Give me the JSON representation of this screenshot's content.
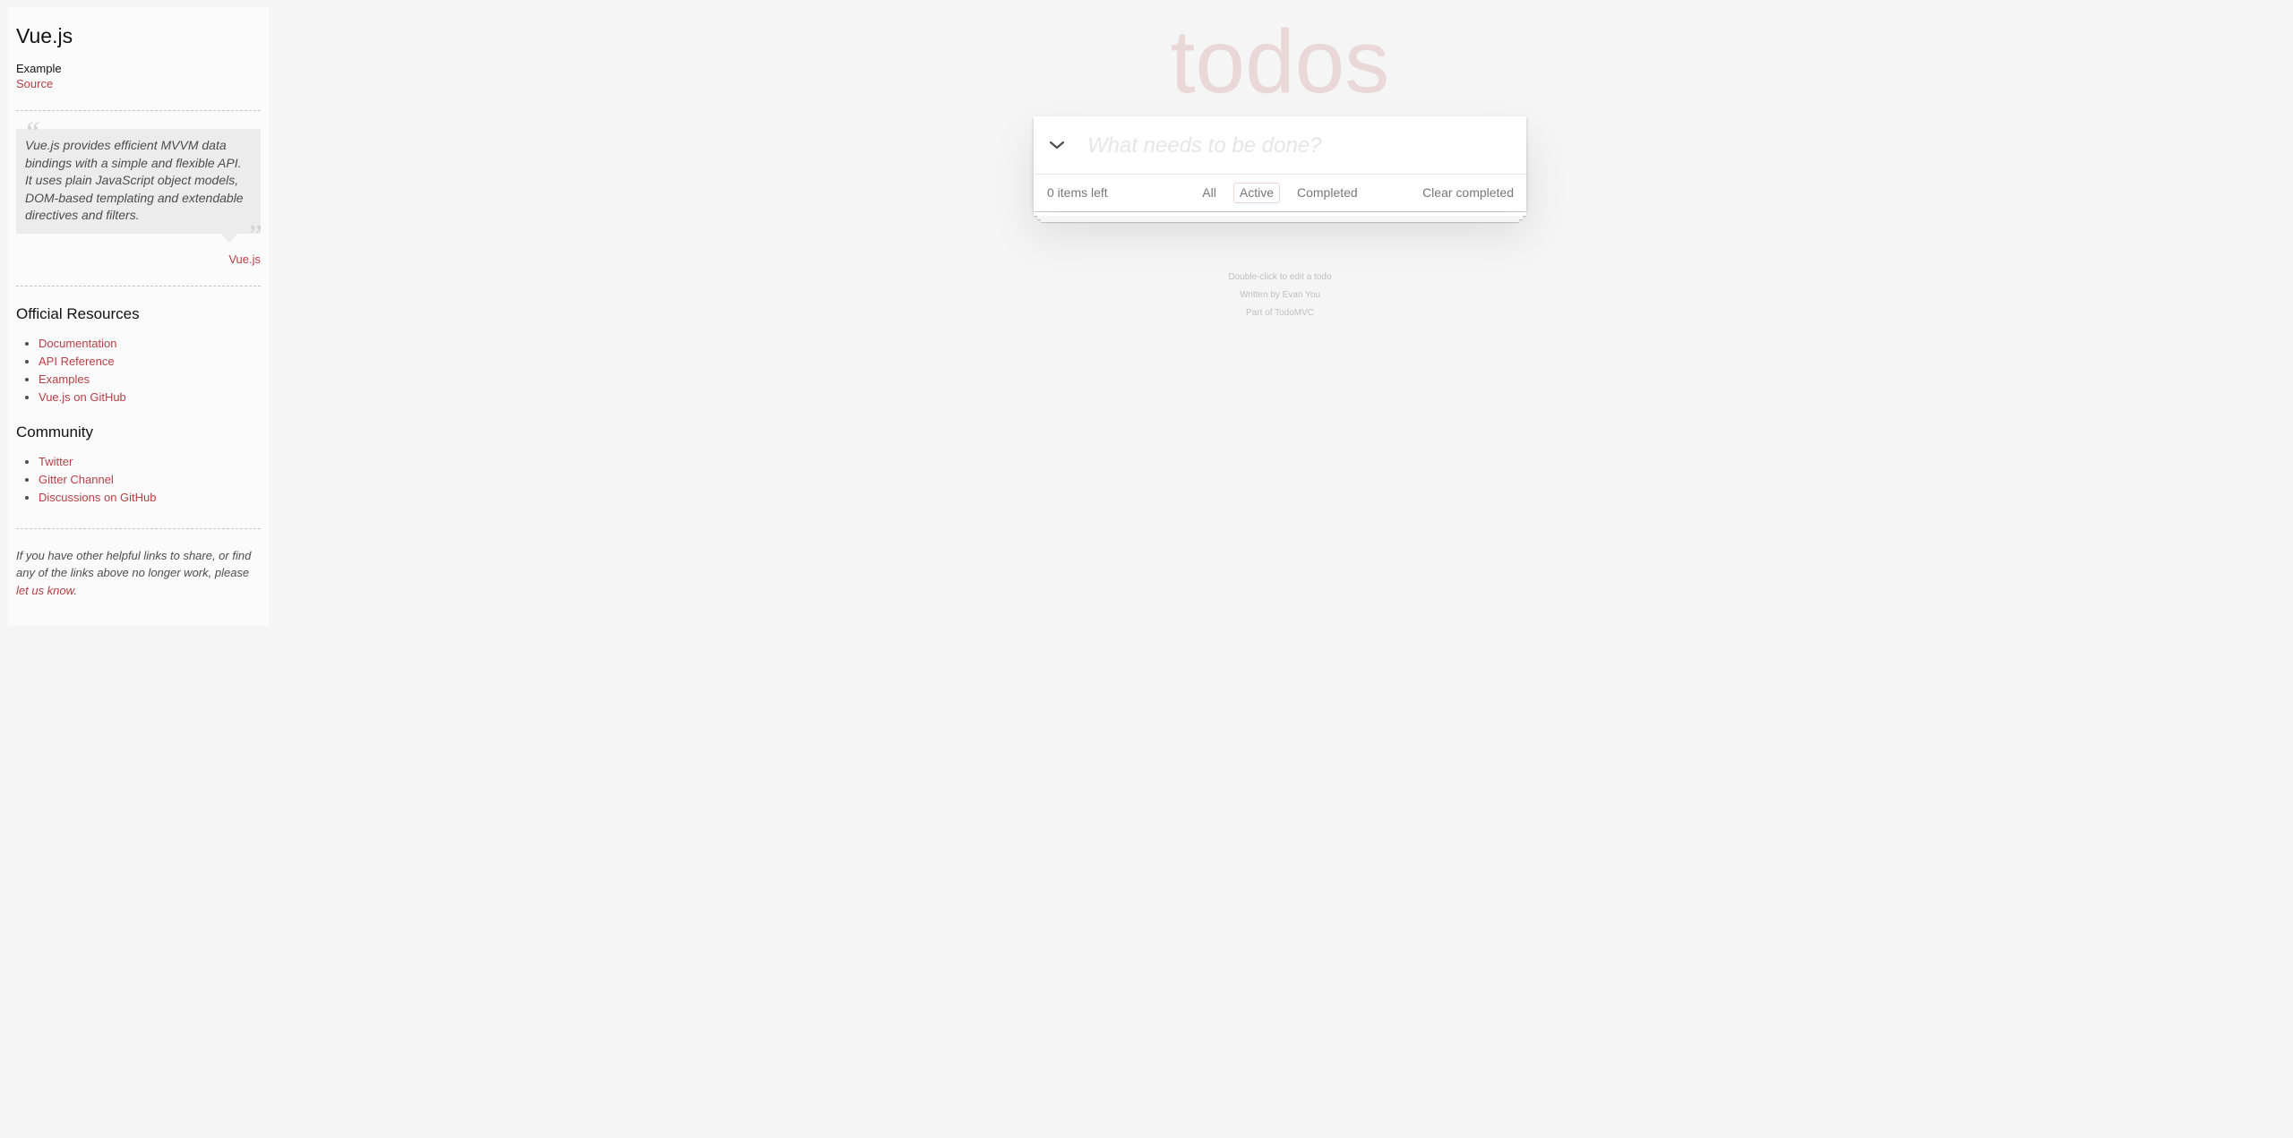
{
  "sidebar": {
    "title": "Vue.js",
    "example_label": "Example",
    "source_link": "Source",
    "quote": "Vue.js provides efficient MVVM data bindings with a simple and flexible API. It uses plain JavaScript object models, DOM-based templating and extendable directives and filters.",
    "quote_source": "Vue.js",
    "official_resources": {
      "heading": "Official Resources",
      "links": [
        "Documentation",
        "API Reference",
        "Examples",
        "Vue.js on GitHub"
      ]
    },
    "community": {
      "heading": "Community",
      "links": [
        "Twitter",
        "Gitter Channel",
        "Discussions on GitHub"
      ]
    },
    "note_prefix": "If you have other helpful links to share, or find any of the links above no longer work, please ",
    "note_link": "let us know",
    "note_suffix": "."
  },
  "app": {
    "title": "todos",
    "new_todo_placeholder": "What needs to be done?",
    "new_todo_value": "",
    "toggle_all_icon": "chevron-down-icon",
    "count_text": "0 items left",
    "filters": [
      "All",
      "Active",
      "Completed"
    ],
    "selected_filter": "Active",
    "clear_completed": "Clear completed"
  },
  "info": {
    "line1": "Double-click to edit a todo",
    "line2_prefix": "Written by ",
    "line2_link": "Evan You",
    "line3_prefix": "Part of ",
    "line3_link": "TodoMVC"
  },
  "colors": {
    "accent": "#b83f45",
    "title": "#ead7d7",
    "background": "#f5f5f5"
  }
}
